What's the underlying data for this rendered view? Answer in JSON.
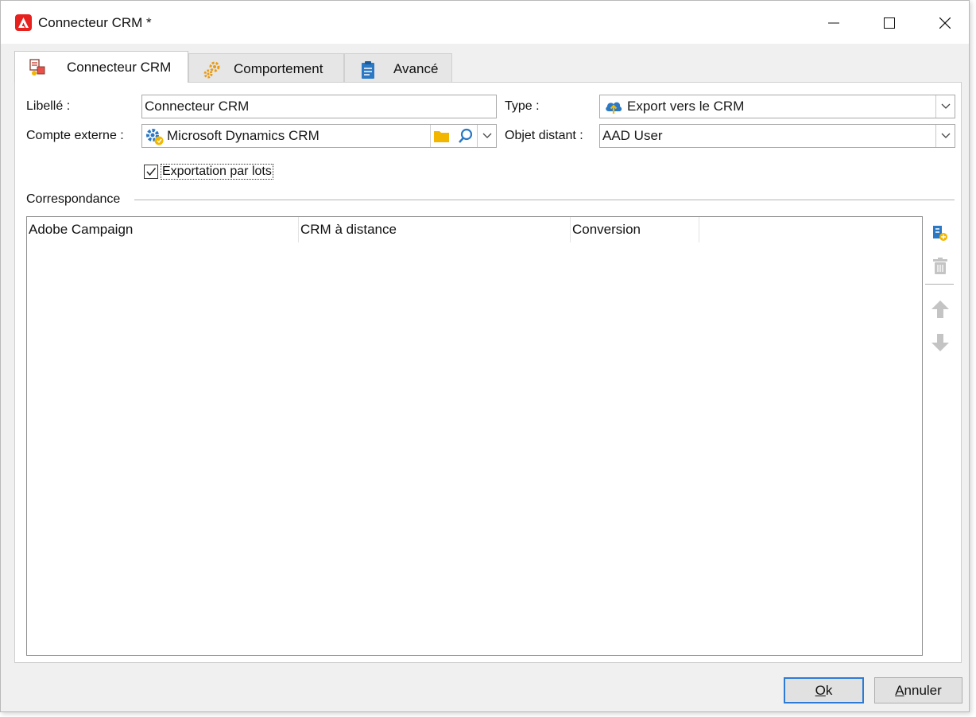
{
  "window": {
    "title": "Connecteur CRM *",
    "controls": {
      "minimize": "minimize-icon",
      "maximize": "maximize-icon",
      "close": "close-icon"
    }
  },
  "tabs": [
    {
      "label": "Connecteur CRM",
      "icon": "crm-connector-icon",
      "active": true
    },
    {
      "label": "Comportement",
      "icon": "gears-icon",
      "active": false
    },
    {
      "label": "Avancé",
      "icon": "clipboard-icon",
      "active": false
    }
  ],
  "form": {
    "label_field": {
      "label": "Libellé :",
      "value": "Connecteur CRM"
    },
    "type_field": {
      "label": "Type :",
      "value": "Export vers le CRM",
      "icon": "cloud-upload-icon"
    },
    "external_account": {
      "label": "Compte externe :",
      "value": "Microsoft Dynamics CRM",
      "icon": "external-account-icon"
    },
    "remote_object": {
      "label": "Objet distant :",
      "value": "AAD User"
    },
    "batch_export": {
      "label": "Exportation par lots",
      "checked": true
    }
  },
  "mapping": {
    "group_title": "Correspondance",
    "columns": [
      "Adobe Campaign",
      "CRM à distance",
      "Conversion"
    ],
    "rows": []
  },
  "side_toolbar": [
    "add-mapping-icon",
    "delete-icon",
    "move-up-icon",
    "move-down-icon"
  ],
  "footer": {
    "ok": {
      "prefix": "",
      "accel": "O",
      "rest": "k"
    },
    "cancel": {
      "prefix": "",
      "accel": "A",
      "rest": "nnuler"
    }
  },
  "colors": {
    "accent": "#2e7bd6",
    "brand": "#e6211e",
    "folder": "#f2b600",
    "disabled_icon": "#c4c4c4"
  }
}
